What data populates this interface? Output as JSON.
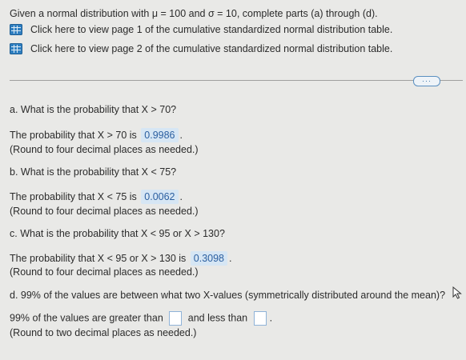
{
  "header": {
    "problem_text": "Given a normal distribution with μ = 100 and σ = 10, complete parts (a) through (d).",
    "links": [
      {
        "label": "Click here to view page 1 of the cumulative standardized normal distribution table.",
        "icon": "table-icon"
      },
      {
        "label": "Click here to view page 2 of the cumulative standardized normal distribution table.",
        "icon": "table-icon"
      }
    ],
    "more_label": "···"
  },
  "parts": {
    "a": {
      "question": "a. What is the probability that X > 70?",
      "answer_prefix": "The probability that X > 70 is",
      "answer": "0.9986",
      "answer_suffix": ".",
      "rounding": "(Round to four decimal places as needed.)"
    },
    "b": {
      "question": "b. What is the probability that X < 75?",
      "answer_prefix": "The probability that X < 75 is",
      "answer": "0.0062",
      "answer_suffix": ".",
      "rounding": "(Round to four decimal places as needed.)"
    },
    "c": {
      "question": "c. What is the probability that X < 95 or X > 130?",
      "answer_prefix": "The probability that X < 95 or X > 130 is",
      "answer": "0.3098",
      "answer_suffix": ".",
      "rounding": "(Round to four decimal places as needed.)"
    },
    "d": {
      "question": "d. 99% of the values are between what two X-values (symmetrically distributed around the mean)?",
      "answer_part1": "99% of the values are greater than",
      "answer_part2": "and less than",
      "answer_suffix": ".",
      "lower_value": "",
      "upper_value": "",
      "rounding": "(Round to two decimal places as needed.)"
    }
  },
  "colors": {
    "background": "#e9e9e7",
    "answer_highlight": "#d6e6f4",
    "answer_text": "#2b5fa0",
    "link_icon": "#2f7fc1"
  }
}
